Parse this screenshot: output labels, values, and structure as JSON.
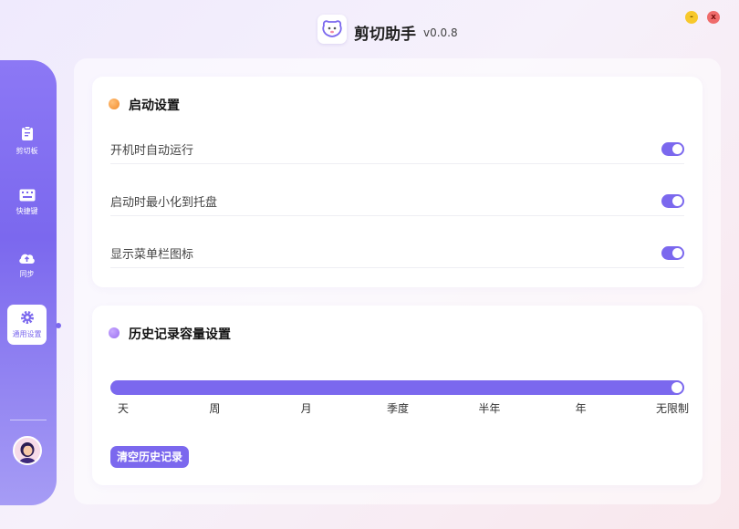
{
  "app": {
    "title": "剪切助手",
    "version": "v0.0.8",
    "logo_icon": "dog-face-icon"
  },
  "window": {
    "minimize_label": "-",
    "close_label": "x"
  },
  "sidebar": {
    "items": [
      {
        "label": "剪切板",
        "icon": "clipboard-icon",
        "active": false
      },
      {
        "label": "快捷键",
        "icon": "keyboard-icon",
        "active": false
      },
      {
        "label": "同步",
        "icon": "cloud-upload-icon",
        "active": false
      },
      {
        "label": "通用设置",
        "icon": "gear-icon",
        "active": true
      }
    ],
    "avatar_icon": "user-avatar-icon"
  },
  "startup": {
    "title": "启动设置",
    "rows": [
      {
        "label": "开机时自动运行",
        "enabled": true
      },
      {
        "label": "启动时最小化到托盘",
        "enabled": true
      },
      {
        "label": "显示菜单栏图标",
        "enabled": true
      }
    ]
  },
  "history": {
    "title": "历史记录容量设置",
    "ticks": [
      "天",
      "周",
      "月",
      "季度",
      "半年",
      "年",
      "无限制"
    ],
    "selected_index": 6,
    "clear_label": "清空历史记录"
  },
  "colors": {
    "accent": "#7b68ee",
    "startup_bullet": "#f28b2a",
    "history_bullet": "#9a70f0"
  }
}
